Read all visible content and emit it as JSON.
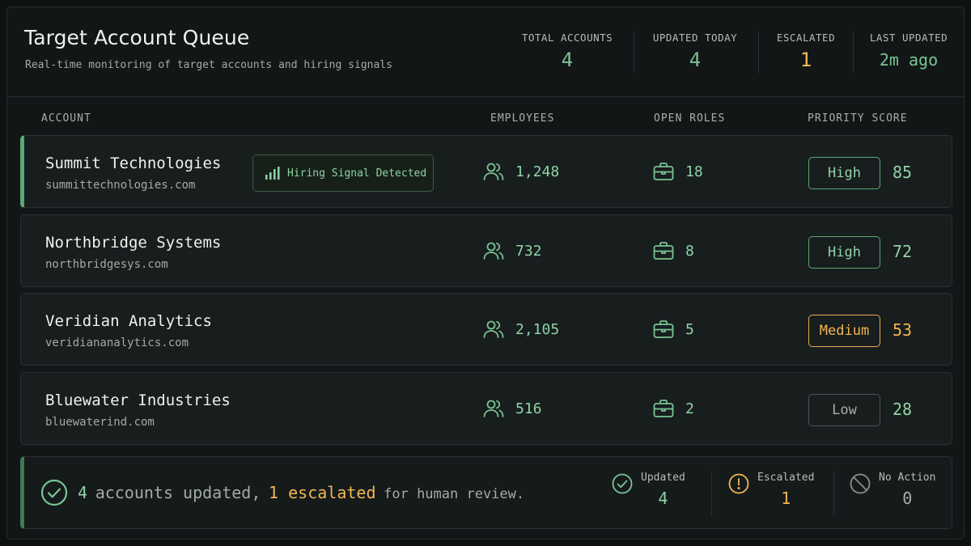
{
  "header": {
    "title": "Target Account Queue",
    "subtitle": "Real-time monitoring of target accounts and hiring signals",
    "stats": [
      {
        "label": "TOTAL ACCOUNTS",
        "value": "4"
      },
      {
        "label": "UPDATED TODAY",
        "value": "4"
      },
      {
        "label": "ESCALATED",
        "value": "1"
      },
      {
        "label": "LAST UPDATED",
        "value": "2m ago"
      }
    ]
  },
  "columns": [
    "ACCOUNT",
    "EMPLOYEES",
    "OPEN ROLES",
    "PRIORITY SCORE"
  ],
  "rows": [
    {
      "name": "Summit Technologies",
      "domain": "summittechnologies.com",
      "signal": "Hiring Signal Detected",
      "employees": "1,248",
      "roles": "18",
      "priority": "High",
      "score": "85"
    },
    {
      "name": "Northbridge Systems",
      "domain": "northbridgesys.com",
      "employees": "732",
      "roles": "8",
      "priority": "High",
      "score": "72"
    },
    {
      "name": "Veridian Analytics",
      "domain": "veridiananalytics.com",
      "employees": "2,105",
      "roles": "5",
      "priority": "Medium",
      "score": "53"
    },
    {
      "name": "Bluewater Industries",
      "domain": "bluewaterind.com",
      "employees": "516",
      "roles": "2",
      "priority": "Low",
      "score": "28"
    }
  ],
  "footer": {
    "count": "4",
    "accounts_updated": "accounts updated,",
    "escalated": "1 escalated",
    "tail": "for human review.",
    "stats": [
      {
        "label": "Updated",
        "value": "4"
      },
      {
        "label": "Escalated",
        "value": "1"
      },
      {
        "label": "No Action",
        "value": "0"
      }
    ]
  },
  "colors": {
    "accent": "#8fd3a5",
    "warning": "#f2b653",
    "muted": "#a8afaa"
  }
}
